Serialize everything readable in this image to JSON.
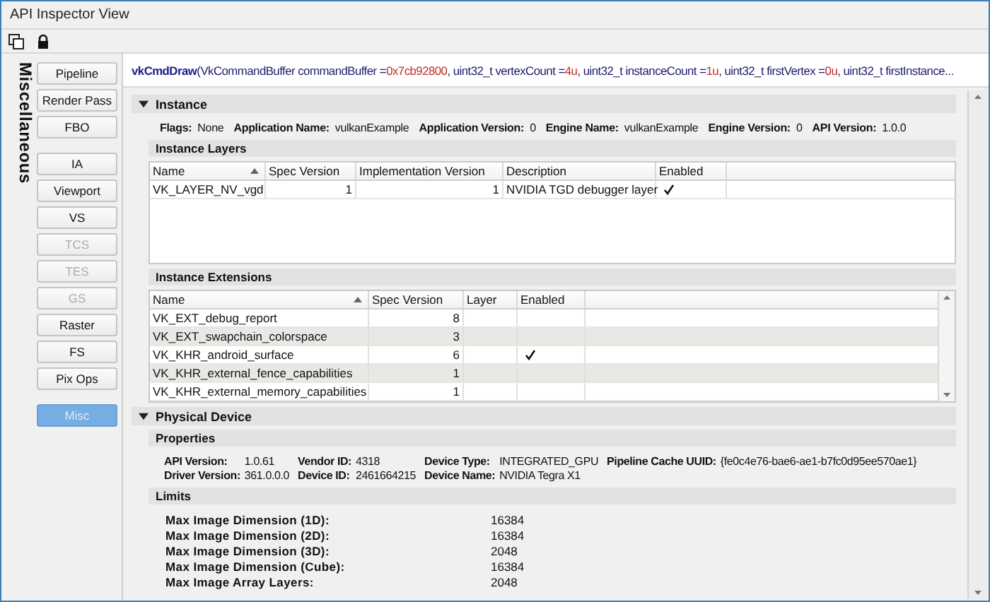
{
  "window": {
    "title": "API Inspector View"
  },
  "sidebar": {
    "title": "Miscellaneous",
    "groups": [
      [
        {
          "label": "Pipeline",
          "disabled": false,
          "selected": false
        },
        {
          "label": "Render Pass",
          "disabled": false,
          "selected": false
        },
        {
          "label": "FBO",
          "disabled": false,
          "selected": false
        }
      ],
      [
        {
          "label": "IA",
          "disabled": false,
          "selected": false
        },
        {
          "label": "Viewport",
          "disabled": false,
          "selected": false
        },
        {
          "label": "VS",
          "disabled": false,
          "selected": false
        },
        {
          "label": "TCS",
          "disabled": true,
          "selected": false
        },
        {
          "label": "TES",
          "disabled": true,
          "selected": false
        },
        {
          "label": "GS",
          "disabled": true,
          "selected": false
        },
        {
          "label": "Raster",
          "disabled": false,
          "selected": false
        },
        {
          "label": "FS",
          "disabled": false,
          "selected": false
        },
        {
          "label": "Pix Ops",
          "disabled": false,
          "selected": false
        }
      ],
      [
        {
          "label": "Misc",
          "disabled": false,
          "selected": true
        }
      ]
    ]
  },
  "call": [
    {
      "kind": "function",
      "text": "vkCmdDraw"
    },
    {
      "kind": "text",
      "text": "(VkCommandBuffer commandBuffer = "
    },
    {
      "kind": "value",
      "text": "0x7cb92800"
    },
    {
      "kind": "text",
      "text": ", uint32_t vertexCount = "
    },
    {
      "kind": "value",
      "text": "4u"
    },
    {
      "kind": "text",
      "text": ", uint32_t instanceCount = "
    },
    {
      "kind": "value",
      "text": "1u"
    },
    {
      "kind": "text",
      "text": ", uint32_t firstVertex = "
    },
    {
      "kind": "value",
      "text": "0u"
    },
    {
      "kind": "text",
      "text": ", uint32_t firstInstance..."
    }
  ],
  "sections": [
    {
      "title": "Instance",
      "expanded": true,
      "blocks": [
        {
          "kind": "fields",
          "fields": [
            {
              "label": "Flags:",
              "value": "None"
            },
            {
              "label": "Application Name:",
              "value": "vulkanExample"
            },
            {
              "label": "Application Version:",
              "value": "0"
            },
            {
              "label": "Engine Name:",
              "value": "vulkanExample"
            },
            {
              "label": "Engine Version:",
              "value": "0"
            },
            {
              "label": "API Version:",
              "value": "1.0.0"
            }
          ]
        },
        {
          "kind": "table",
          "title": "Instance Layers",
          "columns": [
            {
              "label": "Name",
              "sorted": true
            },
            {
              "label": "Spec Version",
              "sorted": false
            },
            {
              "label": "Implementation Version",
              "sorted": false
            },
            {
              "label": "Description",
              "sorted": false
            },
            {
              "label": "Enabled",
              "sorted": false
            }
          ],
          "rows": [
            {
              "cells": [
                "VK_LAYER_NV_vgd",
                "1",
                "1",
                "NVIDIA TGD debugger layer"
              ],
              "enabled": true
            }
          ]
        },
        {
          "kind": "table",
          "title": "Instance Extensions",
          "columns": [
            {
              "label": "Name",
              "sorted": true
            },
            {
              "label": "Spec Version",
              "sorted": false
            },
            {
              "label": "Layer",
              "sorted": false
            },
            {
              "label": "Enabled",
              "sorted": false
            }
          ],
          "rows": [
            {
              "cells": [
                "VK_EXT_debug_report",
                "8"
              ],
              "enabled": false
            },
            {
              "cells": [
                "VK_EXT_swapchain_colorspace",
                "3"
              ],
              "enabled": false
            },
            {
              "cells": [
                "VK_KHR_android_surface",
                "6"
              ],
              "enabled": true
            },
            {
              "cells": [
                "VK_KHR_external_fence_capabilities",
                "1"
              ],
              "enabled": false
            },
            {
              "cells": [
                "VK_KHR_external_memory_capabilities",
                "1"
              ],
              "enabled": false
            }
          ]
        }
      ]
    },
    {
      "title": "Physical Device",
      "expanded": true,
      "blocks": [
        {
          "kind": "grid",
          "title": "Properties",
          "fields": [
            {
              "label": "API Version:",
              "value": "1.0.61"
            },
            {
              "label": "Vendor ID:",
              "value": "4318"
            },
            {
              "label": "Device Type:",
              "value": "INTEGRATED_GPU"
            },
            {
              "label": "Pipeline Cache UUID:",
              "value": "{fe0c4e76-bae6-ae1-b7fc0d95ee570ae1}"
            },
            {
              "label": "Driver Version:",
              "value": "361.0.0.0"
            },
            {
              "label": "Device ID:",
              "value": "2461664215"
            },
            {
              "label": "Device Name:",
              "value": "NVIDIA Tegra X1"
            }
          ]
        },
        {
          "kind": "limits",
          "title": "Limits",
          "rows": [
            {
              "label": "Max Image Dimension (1D):",
              "value": "16384"
            },
            {
              "label": "Max Image Dimension (2D):",
              "value": "16384"
            },
            {
              "label": "Max Image Dimension (3D):",
              "value": "2048"
            },
            {
              "label": "Max Image Dimension (Cube):",
              "value": "16384"
            },
            {
              "label": "Max Image Array Layers:",
              "value": "2048"
            }
          ]
        }
      ]
    }
  ]
}
